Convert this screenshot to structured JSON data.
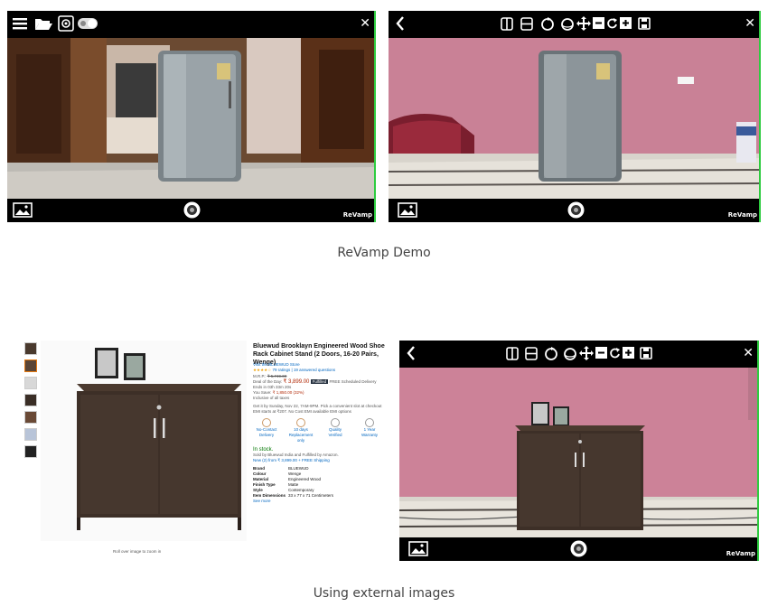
{
  "captions": {
    "top": "ReVamp Demo",
    "bottom": "Using external images"
  },
  "brand": "ReVamp",
  "close_glyph": "✕",
  "colors": {
    "accent_green": "#2ecc40",
    "wall_pink": "#c9879a",
    "cabinet_brown": "#3d2f27"
  },
  "toolbar_icons": [
    "split-view-icon",
    "split-horizontal-icon",
    "rotate-icon",
    "rotate-3d-icon",
    "move-icon",
    "zoom-out-icon",
    "reset-icon",
    "zoom-in-icon",
    "save-icon"
  ],
  "amazon": {
    "title": "Bluewud Brooklayn Engineered Wood Shoe Rack Cabinet Stand (2 Doors, 16-20 Pairs, Wenge)",
    "store": "Visit the BLUEWUD Store",
    "ratings": "79 ratings | 19 answered questions",
    "mrp_label": "M.R.P.:",
    "mrp": "₹ 5,749.00",
    "deal_label": "Deal of the Day:",
    "deal_price": "₹ 3,899.00",
    "fulfilled": "Fulfilled",
    "delivery": "FREE Scheduled Delivery",
    "ends": "Ends in 03h 33m 20s",
    "save_label": "You Save:",
    "save": "₹ 1,850.00 (32%)",
    "taxes": "Inclusive of all taxes",
    "get_it": "Get it by Sunday, Nov 22, 7AM-9PM. Pick a convenient slot at checkout",
    "emi": "EMI starts at ₹207. No Cost EMI available EMI options",
    "features": [
      "No-Contact Delivery",
      "10 days Replacement only",
      "Quality Verified",
      "1 Year Warranty"
    ],
    "stock": "In stock.",
    "sold_by": "Sold by Bluewud India and Fulfilled by Amazon.",
    "new": "New (2) from ₹ 3,899.00 + FREE Shipping",
    "specs": [
      [
        "Brand",
        "BLUEWUD"
      ],
      [
        "Colour",
        "Wenge"
      ],
      [
        "Material",
        "Engineered Wood"
      ],
      [
        "Finish Type",
        "Matte"
      ],
      [
        "Style",
        "Contemporary"
      ],
      [
        "Item Dimensions",
        "33 x 77 x 71 Centimeters"
      ]
    ],
    "see_more": "See more",
    "zoom_hint": "Roll over image to zoom in"
  }
}
